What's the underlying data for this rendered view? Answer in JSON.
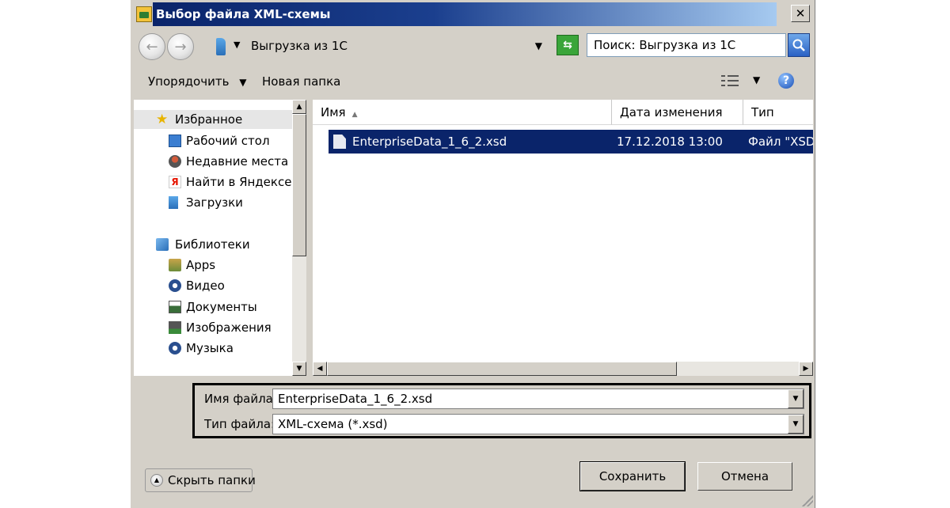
{
  "window": {
    "title": "Выбор файла XML-схемы",
    "close_glyph": "✕"
  },
  "address": {
    "path": "Выгрузка из 1С",
    "search_placeholder": "Поиск: Выгрузка из 1С"
  },
  "toolbar": {
    "organize_label": "Упорядочить",
    "new_folder_label": "Новая папка",
    "help_glyph": "?"
  },
  "sidebar": {
    "items": [
      {
        "label": "Избранное",
        "icon": "star-icon"
      },
      {
        "label": "Рабочий стол",
        "icon": "desktop-icon"
      },
      {
        "label": "Недавние места",
        "icon": "recent-places-icon"
      },
      {
        "label": "Найти в Яндексе",
        "icon": "yandex-icon"
      },
      {
        "label": "Загрузки",
        "icon": "downloads-icon"
      },
      {
        "label": "Библиотеки",
        "icon": "libraries-icon"
      },
      {
        "label": "Apps",
        "icon": "apps-icon"
      },
      {
        "label": "Видео",
        "icon": "video-icon"
      },
      {
        "label": "Документы",
        "icon": "documents-icon"
      },
      {
        "label": "Изображения",
        "icon": "images-icon"
      },
      {
        "label": "Музыка",
        "icon": "music-icon"
      }
    ]
  },
  "file_list": {
    "columns": [
      "Имя",
      "Дата изменения",
      "Тип"
    ],
    "rows": [
      {
        "name": "EnterpriseData_1_6_2.xsd",
        "date": "17.12.2018 13:00",
        "type": "Файл \"XSD\""
      }
    ]
  },
  "fields": {
    "filename_label": "Имя файла:",
    "filename_value": "EnterpriseData_1_6_2.xsd",
    "filetype_label": "Тип файла:",
    "filetype_value": "XML-схема (*.xsd)"
  },
  "buttons": {
    "hide_folders": "Скрыть папки",
    "save": "Сохранить",
    "cancel": "Отмена"
  },
  "colors": {
    "title_bar": "#0a246a",
    "selection": "#0a246a",
    "dialog_bg": "#d4d0c8"
  }
}
